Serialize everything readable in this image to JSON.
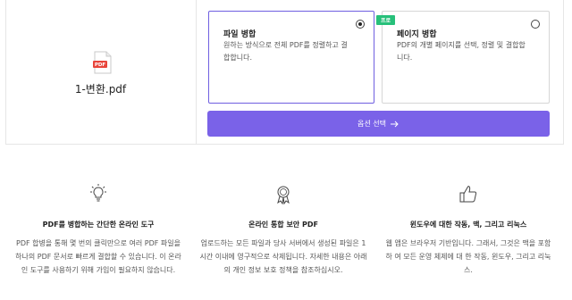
{
  "file": {
    "name": "1-변환.pdf",
    "icon": "pdf-file-icon"
  },
  "options": [
    {
      "title": "파일 병합",
      "description": "원하는 방식으로 전체 PDF를 정렬하고 결합합니다.",
      "selected": true,
      "badge": ""
    },
    {
      "title": "페이지 병합",
      "description": "PDF의 개별 페이지를 선택, 정렬 및 결합합니다.",
      "selected": false,
      "badge": "프로"
    }
  ],
  "action_button": {
    "label": "옵션 선택",
    "icon": "arrow-right-icon"
  },
  "features": [
    {
      "icon": "lightbulb-icon",
      "title": "PDF를 병합하는 간단한 온라인 도구",
      "text": "PDF 합병을 통해 몇 번의 클릭만으로 여러 PDF 파일을 하나의 PDF 문서로 빠르게 결합할 수 있습니다. 이 온라인 도구를 사용하기 위해 가입이 필요하지 않습니다."
    },
    {
      "icon": "award-icon",
      "title": "온라인 통합 보안 PDF",
      "text": "업로드하는 모든 파일과 당사 서버에서 생성된 파일은 1시간 이내에 영구적으로 삭제됩니다. 자세한 내용은 아래의 개인 정보 보호 정책을 참조하십시오."
    },
    {
      "icon": "thumbs-up-icon",
      "title": "윈도우에 대한 작동, 맥, 그리고 리눅스",
      "text": "웹 앱은 브라우저 기반입니다. 그래서, 그것은 맥을 포함 하 여 모든 운영 체제에 대 한 작동, 윈도우, 그리고 리눅스."
    }
  ],
  "colors": {
    "accent": "#7a62e8",
    "badge": "#27c07a",
    "pdf_red": "#e8443a"
  }
}
